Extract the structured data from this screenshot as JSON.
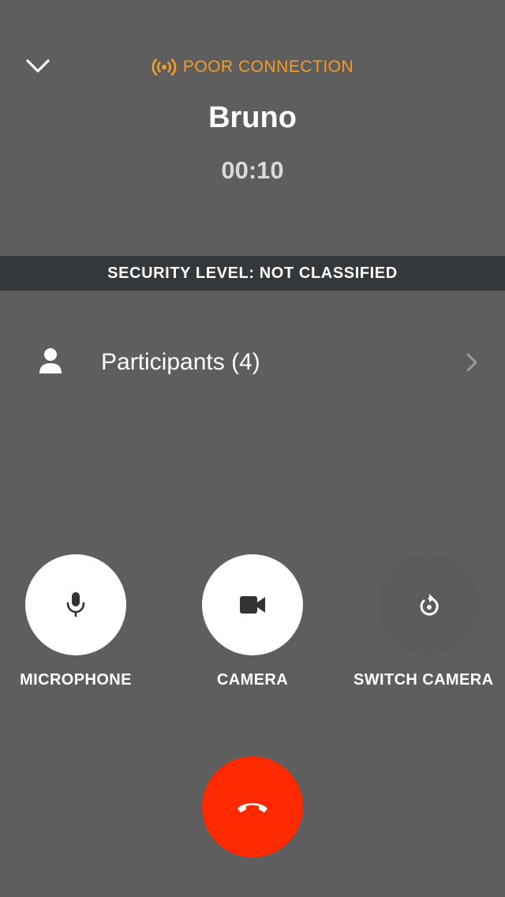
{
  "header": {
    "connection_status": "POOR CONNECTION",
    "caller_name": "Bruno",
    "timer": "00:10"
  },
  "security": {
    "label": "SECURITY LEVEL: NOT CLASSIFIED"
  },
  "participants": {
    "label": "Participants (4)"
  },
  "controls": {
    "microphone_label": "MICROPHONE",
    "camera_label": "CAMERA",
    "switch_camera_label": "SWITCH CAMERA"
  },
  "colors": {
    "background": "#5e5e5e",
    "warning": "#f39c26",
    "security_bar": "#35383b",
    "hangup": "#ff2a00"
  },
  "icons": {
    "collapse": "chevron-down-icon",
    "connection": "signal-broadcast-icon",
    "participants": "person-icon",
    "participants_more": "chevron-right-icon",
    "microphone": "microphone-icon",
    "camera": "video-camera-icon",
    "switch_camera": "rotate-camera-icon",
    "hangup": "phone-hangup-icon"
  }
}
